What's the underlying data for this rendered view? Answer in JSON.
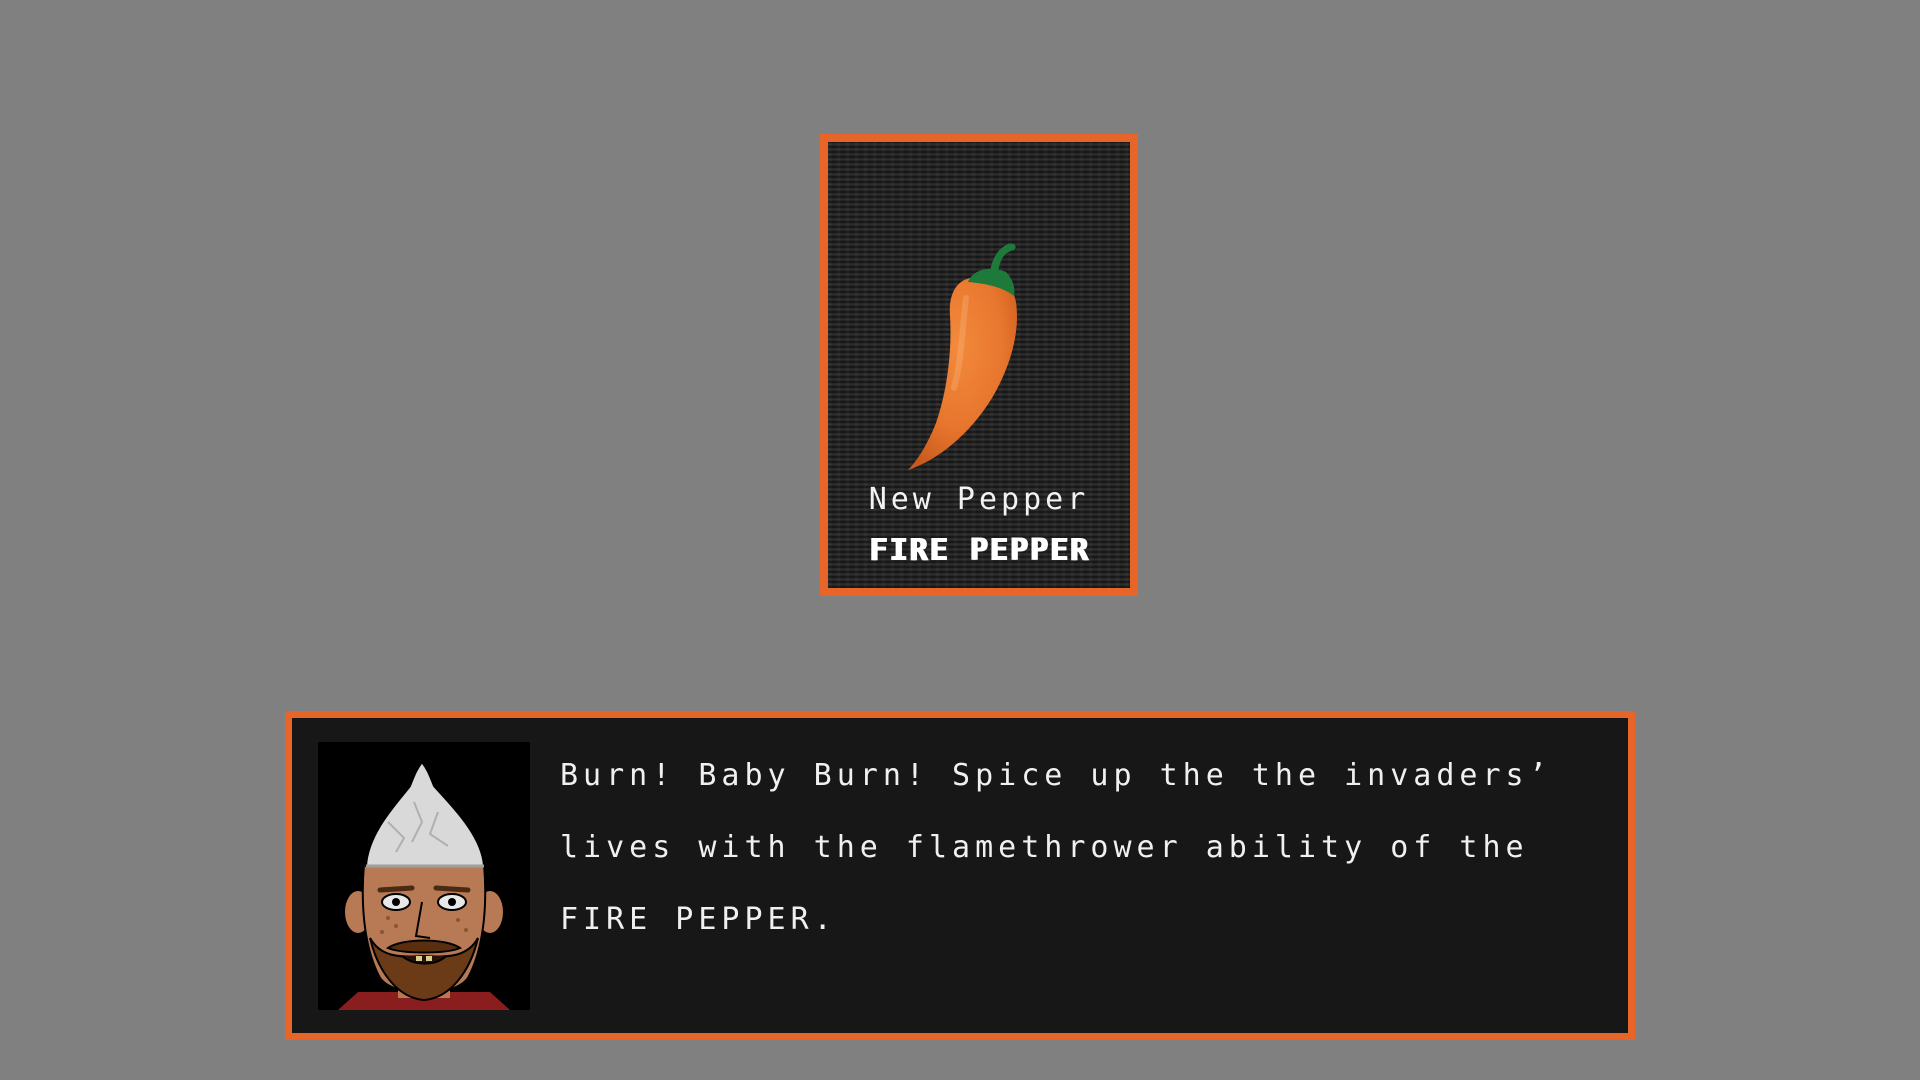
{
  "card": {
    "subtitle": "New Pepper",
    "title": "FIRE PEPPER",
    "art_icon": "chili-pepper-icon",
    "border_color": "#e8652a",
    "pepper_color": "#e8762e",
    "stem_color": "#1e7a3a"
  },
  "dialog": {
    "portrait_icon": "tinfoil-hat-man-portrait",
    "text": "Burn! Baby Burn! Spice up the the invaders’ lives with the flamethrower ability of the FIRE PEPPER.",
    "border_color": "#e8652a",
    "background_color": "#171717"
  },
  "background_color": "#808080"
}
